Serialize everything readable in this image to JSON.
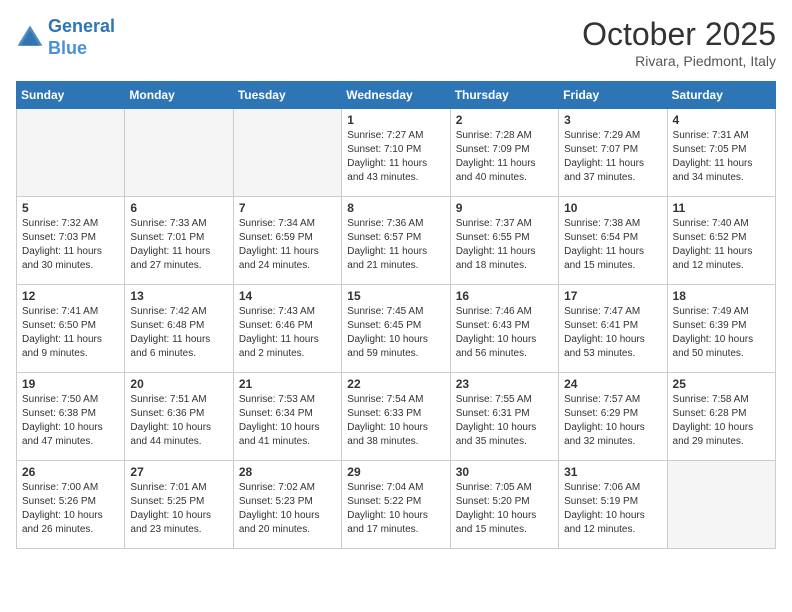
{
  "header": {
    "logo_line1": "General",
    "logo_line2": "Blue",
    "month_title": "October 2025",
    "location": "Rivara, Piedmont, Italy"
  },
  "days_of_week": [
    "Sunday",
    "Monday",
    "Tuesday",
    "Wednesday",
    "Thursday",
    "Friday",
    "Saturday"
  ],
  "weeks": [
    [
      {
        "num": "",
        "info": ""
      },
      {
        "num": "",
        "info": ""
      },
      {
        "num": "",
        "info": ""
      },
      {
        "num": "1",
        "info": "Sunrise: 7:27 AM\nSunset: 7:10 PM\nDaylight: 11 hours\nand 43 minutes."
      },
      {
        "num": "2",
        "info": "Sunrise: 7:28 AM\nSunset: 7:09 PM\nDaylight: 11 hours\nand 40 minutes."
      },
      {
        "num": "3",
        "info": "Sunrise: 7:29 AM\nSunset: 7:07 PM\nDaylight: 11 hours\nand 37 minutes."
      },
      {
        "num": "4",
        "info": "Sunrise: 7:31 AM\nSunset: 7:05 PM\nDaylight: 11 hours\nand 34 minutes."
      }
    ],
    [
      {
        "num": "5",
        "info": "Sunrise: 7:32 AM\nSunset: 7:03 PM\nDaylight: 11 hours\nand 30 minutes."
      },
      {
        "num": "6",
        "info": "Sunrise: 7:33 AM\nSunset: 7:01 PM\nDaylight: 11 hours\nand 27 minutes."
      },
      {
        "num": "7",
        "info": "Sunrise: 7:34 AM\nSunset: 6:59 PM\nDaylight: 11 hours\nand 24 minutes."
      },
      {
        "num": "8",
        "info": "Sunrise: 7:36 AM\nSunset: 6:57 PM\nDaylight: 11 hours\nand 21 minutes."
      },
      {
        "num": "9",
        "info": "Sunrise: 7:37 AM\nSunset: 6:55 PM\nDaylight: 11 hours\nand 18 minutes."
      },
      {
        "num": "10",
        "info": "Sunrise: 7:38 AM\nSunset: 6:54 PM\nDaylight: 11 hours\nand 15 minutes."
      },
      {
        "num": "11",
        "info": "Sunrise: 7:40 AM\nSunset: 6:52 PM\nDaylight: 11 hours\nand 12 minutes."
      }
    ],
    [
      {
        "num": "12",
        "info": "Sunrise: 7:41 AM\nSunset: 6:50 PM\nDaylight: 11 hours\nand 9 minutes."
      },
      {
        "num": "13",
        "info": "Sunrise: 7:42 AM\nSunset: 6:48 PM\nDaylight: 11 hours\nand 6 minutes."
      },
      {
        "num": "14",
        "info": "Sunrise: 7:43 AM\nSunset: 6:46 PM\nDaylight: 11 hours\nand 2 minutes."
      },
      {
        "num": "15",
        "info": "Sunrise: 7:45 AM\nSunset: 6:45 PM\nDaylight: 10 hours\nand 59 minutes."
      },
      {
        "num": "16",
        "info": "Sunrise: 7:46 AM\nSunset: 6:43 PM\nDaylight: 10 hours\nand 56 minutes."
      },
      {
        "num": "17",
        "info": "Sunrise: 7:47 AM\nSunset: 6:41 PM\nDaylight: 10 hours\nand 53 minutes."
      },
      {
        "num": "18",
        "info": "Sunrise: 7:49 AM\nSunset: 6:39 PM\nDaylight: 10 hours\nand 50 minutes."
      }
    ],
    [
      {
        "num": "19",
        "info": "Sunrise: 7:50 AM\nSunset: 6:38 PM\nDaylight: 10 hours\nand 47 minutes."
      },
      {
        "num": "20",
        "info": "Sunrise: 7:51 AM\nSunset: 6:36 PM\nDaylight: 10 hours\nand 44 minutes."
      },
      {
        "num": "21",
        "info": "Sunrise: 7:53 AM\nSunset: 6:34 PM\nDaylight: 10 hours\nand 41 minutes."
      },
      {
        "num": "22",
        "info": "Sunrise: 7:54 AM\nSunset: 6:33 PM\nDaylight: 10 hours\nand 38 minutes."
      },
      {
        "num": "23",
        "info": "Sunrise: 7:55 AM\nSunset: 6:31 PM\nDaylight: 10 hours\nand 35 minutes."
      },
      {
        "num": "24",
        "info": "Sunrise: 7:57 AM\nSunset: 6:29 PM\nDaylight: 10 hours\nand 32 minutes."
      },
      {
        "num": "25",
        "info": "Sunrise: 7:58 AM\nSunset: 6:28 PM\nDaylight: 10 hours\nand 29 minutes."
      }
    ],
    [
      {
        "num": "26",
        "info": "Sunrise: 7:00 AM\nSunset: 5:26 PM\nDaylight: 10 hours\nand 26 minutes."
      },
      {
        "num": "27",
        "info": "Sunrise: 7:01 AM\nSunset: 5:25 PM\nDaylight: 10 hours\nand 23 minutes."
      },
      {
        "num": "28",
        "info": "Sunrise: 7:02 AM\nSunset: 5:23 PM\nDaylight: 10 hours\nand 20 minutes."
      },
      {
        "num": "29",
        "info": "Sunrise: 7:04 AM\nSunset: 5:22 PM\nDaylight: 10 hours\nand 17 minutes."
      },
      {
        "num": "30",
        "info": "Sunrise: 7:05 AM\nSunset: 5:20 PM\nDaylight: 10 hours\nand 15 minutes."
      },
      {
        "num": "31",
        "info": "Sunrise: 7:06 AM\nSunset: 5:19 PM\nDaylight: 10 hours\nand 12 minutes."
      },
      {
        "num": "",
        "info": ""
      }
    ]
  ]
}
